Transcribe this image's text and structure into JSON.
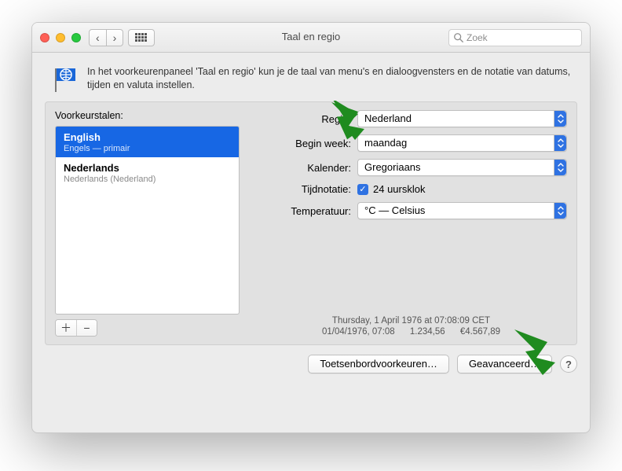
{
  "window": {
    "title": "Taal en regio",
    "search_placeholder": "Zoek"
  },
  "intro": "In het voorkeurenpaneel 'Taal en regio' kun je de taal van menu's en dialoogvensters en de notatie van datums, tijden en valuta instellen.",
  "left": {
    "label": "Voorkeurstalen:",
    "items": [
      {
        "name": "English",
        "sub": "Engels — primair"
      },
      {
        "name": "Nederlands",
        "sub": "Nederlands (Nederland)"
      }
    ]
  },
  "form": {
    "region_label": "Regio:",
    "region_value": "Nederland",
    "week_label": "Begin week:",
    "week_value": "maandag",
    "calendar_label": "Kalender:",
    "calendar_value": "Gregoriaans",
    "time_label": "Tijdnotatie:",
    "time_check_label": "24 uursklok",
    "temp_label": "Temperatuur:",
    "temp_value": "°C — Celsius"
  },
  "sample": {
    "line1": "Thursday, 1 April 1976 at 07:08:09 CET",
    "date": "01/04/1976, 07:08",
    "number": "1.234,56",
    "currency": "€4.567,89"
  },
  "footer": {
    "keyboard": "Toetsenbordvoorkeuren…",
    "advanced": "Geavanceerd…"
  }
}
